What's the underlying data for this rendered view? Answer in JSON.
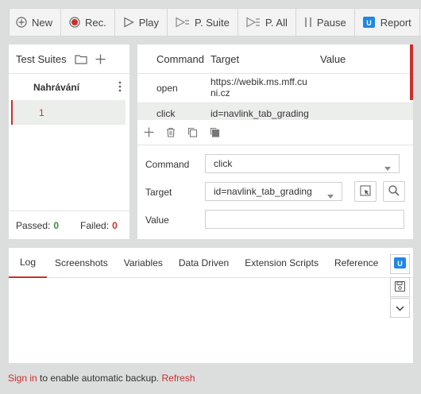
{
  "toolbar": {
    "new_label": "New",
    "rec_label": "Rec.",
    "play_label": "Play",
    "psuite_label": "P. Suite",
    "pall_label": "P. All",
    "pause_label": "Pause",
    "report_label": "Report",
    "extra_label": "{"
  },
  "suites": {
    "title": "Test Suites",
    "suite_name": "Nahrávání",
    "case_name": "1",
    "passed_label": "Passed:",
    "passed_count": "0",
    "failed_label": "Failed:",
    "failed_count": "0"
  },
  "table": {
    "headers": [
      "Command",
      "Target",
      "Value"
    ],
    "rows": [
      {
        "command": "open",
        "target": "https://webik.ms.mff.cuni.cz",
        "value": ""
      },
      {
        "command": "click",
        "target": "id=navlink_tab_grading",
        "value": ""
      }
    ]
  },
  "editor": {
    "command_label": "Command",
    "command_value": "click",
    "target_label": "Target",
    "target_value": "id=navlink_tab_grading",
    "value_label": "Value",
    "value_value": ""
  },
  "log": {
    "tabs": [
      "Log",
      "Screenshots",
      "Variables",
      "Data Driven",
      "Extension Scripts",
      "Reference"
    ]
  },
  "footer": {
    "signin": "Sign in",
    "text": " to enable automatic backup. ",
    "refresh": "Refresh"
  },
  "colors": {
    "accent": "#c9302c",
    "success": "#3c8a3c",
    "report": "#1e88e5"
  }
}
